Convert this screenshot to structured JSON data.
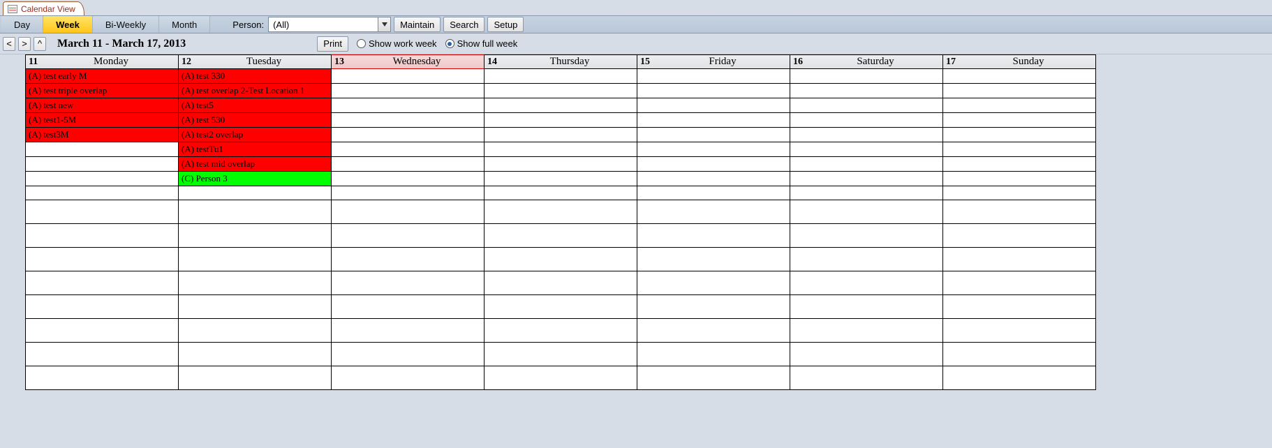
{
  "tab": {
    "title": "Calendar View"
  },
  "views": {
    "day": "Day",
    "week": "Week",
    "biwk": "Bi-Weekly",
    "month": "Month",
    "active": "week"
  },
  "person": {
    "label": "Person:",
    "value": "(All)"
  },
  "buttons": {
    "maintain": "Maintain",
    "search": "Search",
    "setup": "Setup",
    "print": "Print"
  },
  "nav": {
    "prev": "<",
    "next": ">",
    "up": "^"
  },
  "date_range": "March 11 - March 17, 2013",
  "week_mode": {
    "work": "Show work week",
    "full": "Show full week",
    "selected": "full"
  },
  "days": [
    {
      "num": "11",
      "name": "Monday",
      "today": false
    },
    {
      "num": "12",
      "name": "Tuesday",
      "today": false
    },
    {
      "num": "13",
      "name": "Wednesday",
      "today": true
    },
    {
      "num": "14",
      "name": "Thursday",
      "today": false
    },
    {
      "num": "15",
      "name": "Friday",
      "today": false
    },
    {
      "num": "16",
      "name": "Saturday",
      "today": false
    },
    {
      "num": "17",
      "name": "Sunday",
      "today": false
    }
  ],
  "events": {
    "monday": [
      {
        "text": "(A) test early M",
        "color": "red"
      },
      {
        "text": "(A) test triple overlap",
        "color": "red"
      },
      {
        "text": "(A) test new",
        "color": "red"
      },
      {
        "text": "(A) test1-5M",
        "color": "red"
      },
      {
        "text": "(A) test3M",
        "color": "red"
      }
    ],
    "tuesday": [
      {
        "text": "(A) test 330",
        "color": "red"
      },
      {
        "text": "(A) test overlap 2-Test Location 1",
        "color": "red"
      },
      {
        "text": "(A) test5",
        "color": "red"
      },
      {
        "text": "(A) test 530",
        "color": "red"
      },
      {
        "text": "(A) test2 overlap",
        "color": "red"
      },
      {
        "text": "(A) testTu1",
        "color": "red"
      },
      {
        "text": "(A) test mid overlap",
        "color": "red"
      },
      {
        "text": "(C) Person 3",
        "color": "green"
      }
    ]
  },
  "colors": {
    "cat_a": "#ff0000",
    "cat_c": "#00ff00",
    "accent": "#ffc61a"
  }
}
